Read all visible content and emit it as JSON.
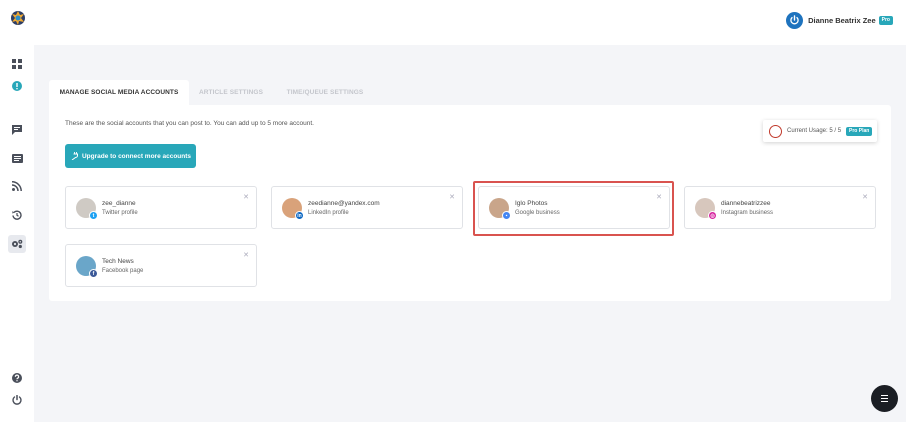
{
  "header": {
    "user_name": "Dianne Beatrix Zee",
    "plan_badge": "Pro"
  },
  "tabs": [
    {
      "label": "MANAGE SOCIAL MEDIA ACCOUNTS",
      "active": true
    },
    {
      "label": "ARTICLE SETTINGS",
      "active": false
    },
    {
      "label": "TIME/QUEUE SETTINGS",
      "active": false
    }
  ],
  "panel": {
    "info_text": "These are the social accounts that you can post to. You can add up to 5 more account.",
    "upgrade_label": "Upgrade to connect more accounts",
    "usage_label": "Current Usage: 5 / 5",
    "usage_badge": "Pro Plan"
  },
  "accounts": [
    {
      "name": "zee_dianne",
      "type": "Twitter profile",
      "network": "twitter",
      "color": "#1da1f2"
    },
    {
      "name": "zeedianne@yandex.com",
      "type": "LinkedIn profile",
      "network": "linkedin",
      "color": "#0a66c2"
    },
    {
      "name": "Iglo Photos",
      "type": "Google business",
      "network": "google-business",
      "color": "#4285f4"
    },
    {
      "name": "diannebeatrizzee",
      "type": "Instagram business",
      "network": "instagram",
      "color": "#d6249f"
    },
    {
      "name": "Tech News",
      "type": "Facebook page",
      "network": "facebook",
      "color": "#3b5998"
    }
  ],
  "colors": {
    "accent": "#28a7b9",
    "highlight": "#d9534f",
    "usage_ring": "#c0392b"
  }
}
